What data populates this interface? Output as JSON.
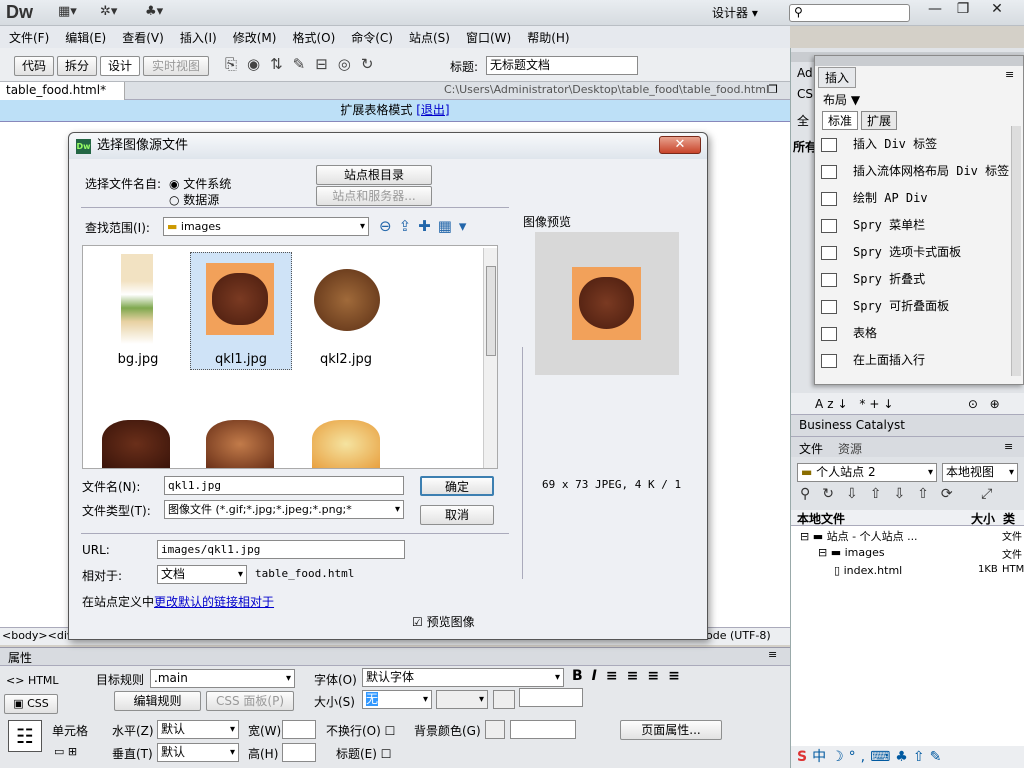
{
  "app": {
    "logo": "Dw",
    "workspace": "设计器",
    "search_placeholder": ""
  },
  "menu": [
    "文件(F)",
    "编辑(E)",
    "查看(V)",
    "插入(I)",
    "修改(M)",
    "格式(O)",
    "命令(C)",
    "站点(S)",
    "窗口(W)",
    "帮助(H)"
  ],
  "toolbar": {
    "code": "代码",
    "split": "拆分",
    "design": "设计",
    "live": "实时视图",
    "title_label": "标题:",
    "title_value": "无标题文档"
  },
  "doc": {
    "tab": "table_food.html*",
    "path": "C:\\Users\\Administrator\\Desktop\\table_food\\table_food.html",
    "banner": "扩展表格模式",
    "exit": "[退出]",
    "status_left": "<body><div",
    "status_right": "ode (UTF-8)"
  },
  "dialog": {
    "title": "选择图像源文件",
    "select_from": "选择文件名自:",
    "filesystem": "文件系统",
    "datasource": "数据源",
    "site_root": "站点根目录",
    "site_server": "站点和服务器...",
    "lookin_label": "查找范围(I):",
    "lookin_value": "images",
    "files": [
      {
        "name": "bg.jpg"
      },
      {
        "name": "qkl1.jpg"
      },
      {
        "name": "qkl2.jpg"
      }
    ],
    "preview_label": "图像预览",
    "preview_info": "69 x 73 JPEG, 4 K / 1",
    "filename_label": "文件名(N):",
    "filename_value": "qkl1.jpg",
    "filetype_label": "文件类型(T):",
    "filetype_value": "图像文件 (*.gif;*.jpg;*.jpeg;*.png;*",
    "ok": "确定",
    "cancel": "取消",
    "url_label": "URL:",
    "url_value": "images/qkl1.jpg",
    "relative_label": "相对于:",
    "relative_value": "文档",
    "relative_file": "table_food.html",
    "site_note": "在站点定义中",
    "site_link": "更改默认的链接相对于",
    "preview_check": "预览图像"
  },
  "insert": {
    "tab": "插入",
    "layout": "布局",
    "std": "标准",
    "ext": "扩展",
    "items": [
      "插入 Div 标签",
      "插入流体网格布局 Div 标签",
      "绘制 AP Div",
      "Spry 菜单栏",
      "Spry 选项卡式面板",
      "Spry 折叠式",
      "Spry 可折叠面板",
      "表格",
      "在上面插入行"
    ]
  },
  "panel": {
    "business": "Business Catalyst",
    "files_tab": "文件",
    "assets_tab": "资源",
    "site": "个人站点 2",
    "view": "本地视图",
    "col_local": "本地文件",
    "col_size": "大小",
    "col_type": "类型",
    "tree": [
      {
        "name": "站点 - 个人站点 ...",
        "size": "",
        "type": "文件"
      },
      {
        "name": "images",
        "size": "",
        "type": "文件"
      },
      {
        "name": "index.html",
        "size": "1KB",
        "type": "HTM"
      }
    ],
    "side_ad": "Ad",
    "side_cs": "CS",
    "side_all": "全",
    "side_all2": "所有"
  },
  "props": {
    "title": "属性",
    "html": "HTML",
    "css": "CSS",
    "target_rule": "目标规则",
    "target_value": ".main",
    "edit_rule": "编辑规则",
    "css_panel": "CSS 面板(P)",
    "font_label": "字体(O)",
    "font_value": "默认字体",
    "size_label": "大小(S)",
    "size_value": "无",
    "cell": "单元格",
    "h_label": "水平(Z)",
    "h_value": "默认",
    "v_label": "垂直(T)",
    "v_value": "默认",
    "w_label": "宽(W)",
    "hh_label": "高(H)",
    "nowrap": "不换行(O)",
    "header": "标题(E)",
    "bg": "背景颜色(G)",
    "page_props": "页面属性..."
  }
}
